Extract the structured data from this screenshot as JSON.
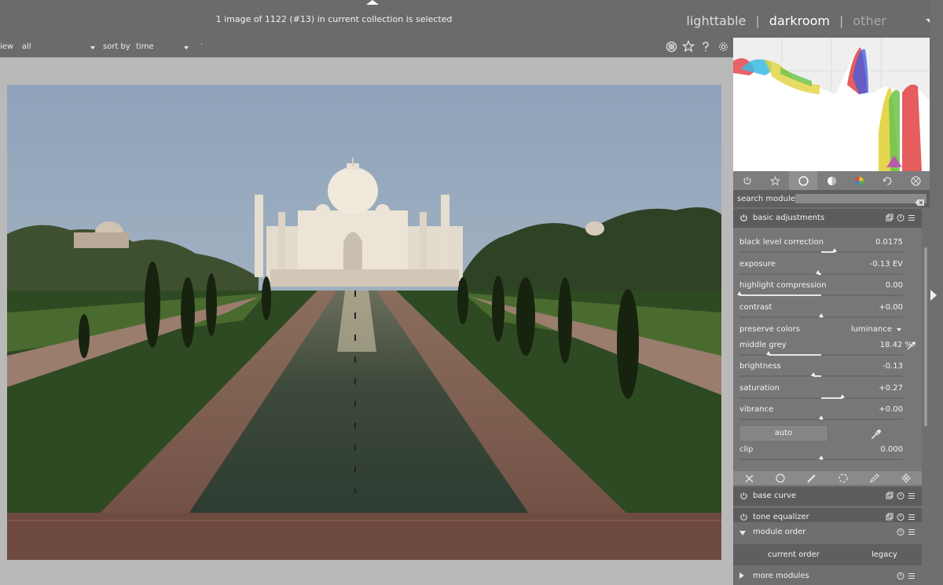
{
  "topbar": {
    "selection_status": "1 image of 1122 (#13) in current collection is selected",
    "views": [
      "lighttable",
      "darkroom",
      "other"
    ],
    "active_view": "darkroom"
  },
  "filterbar": {
    "view_label": "iew",
    "view_value": "all",
    "sort_label": "sort by",
    "sort_value": "time",
    "extra": "·"
  },
  "right_panel": {
    "search_label": "search module",
    "search_placeholder": "",
    "basic_adjustments": {
      "title": "basic adjustments",
      "rows": [
        {
          "label": "black level correction",
          "value": "0.0175",
          "level": 0.58
        },
        {
          "label": "exposure",
          "value": "-0.13 EV",
          "level": 0.48
        },
        {
          "label": "highlight compression",
          "value": "0.00",
          "level": 0.0
        },
        {
          "label": "contrast",
          "value": "+0.00",
          "level": 0.5
        },
        {
          "label": "preserve colors",
          "value": "luminance"
        },
        {
          "label": "middle grey",
          "value": "18.42 %",
          "level": 0.18
        },
        {
          "label": "brightness",
          "value": "-0.13",
          "level": 0.45
        },
        {
          "label": "saturation",
          "value": "+0.27",
          "level": 0.63
        },
        {
          "label": "vibrance",
          "value": "+0.00",
          "level": 0.5
        },
        {
          "label": "clip",
          "value": "0.000",
          "level": 0.5
        }
      ],
      "auto_label": "auto"
    },
    "base_curve": "base curve",
    "tone_equalizer": "tone equalizer",
    "module_order": {
      "title": "module order",
      "current": "current order",
      "legacy": "legacy"
    },
    "more_modules": "more modules"
  },
  "icons": {
    "view_dropdown": "chevron-down-icon",
    "filter_icons": [
      "color-labels-icon",
      "star-icon",
      "help-icon",
      "gear-icon"
    ],
    "module_groups": [
      "power-icon",
      "star-icon",
      "circle-icon",
      "half-circle-icon",
      "color-wheel-icon",
      "rotate-icon",
      "aperture-icon"
    ],
    "tool_strip": [
      "close-icon",
      "circle-icon",
      "brush-icon",
      "gradient-circle-icon",
      "pen-icon",
      "grid-icon"
    ]
  }
}
